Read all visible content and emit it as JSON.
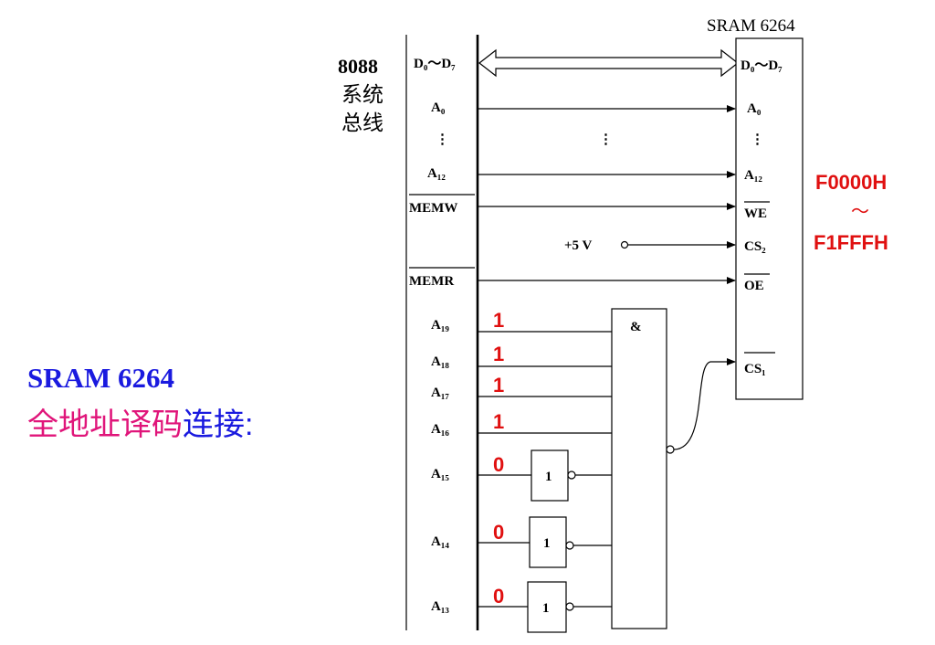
{
  "colors": {
    "title_blue": "#1a1adf",
    "title_pink": "#e0157a",
    "bit_red": "#e01010",
    "range_red": "#e01010",
    "line": "#000000"
  },
  "heading": {
    "chip": "SRAM 6264",
    "desc_pink": "全地址译码",
    "desc_blue": "连接:"
  },
  "bus": {
    "cpu": "8088",
    "line1": "系统",
    "line2": "总线"
  },
  "chip": {
    "title": "SRAM 6264",
    "pins": {
      "d": "D₀～D₇",
      "a0": "A₀",
      "a12": "A₁₂",
      "we": "WE",
      "cs2": "CS₂",
      "oe": "OE",
      "cs1": "CS₁",
      "dots": "⋮"
    }
  },
  "bus_signals": {
    "d": "D₀～D₇",
    "a0": "A₀",
    "dots": "⋮",
    "a12": "A₁₂",
    "memw": "MEMW",
    "memr": "MEMR",
    "vcc": "+5 V"
  },
  "mid_dots": "⋮",
  "decoder": {
    "and_symbol": "&",
    "not_symbol": "1",
    "inputs": [
      {
        "pin": "A₁₉",
        "bit": "1"
      },
      {
        "pin": "A₁₈",
        "bit": "1"
      },
      {
        "pin": "A₁₇",
        "bit": "1"
      },
      {
        "pin": "A₁₆",
        "bit": "1"
      },
      {
        "pin": "A₁₅",
        "bit": "0"
      },
      {
        "pin": "A₁₄",
        "bit": "0"
      },
      {
        "pin": "A₁₃",
        "bit": "0"
      }
    ]
  },
  "address_range": {
    "start": "F0000H",
    "tilde": "～",
    "end": "F1FFFH"
  }
}
